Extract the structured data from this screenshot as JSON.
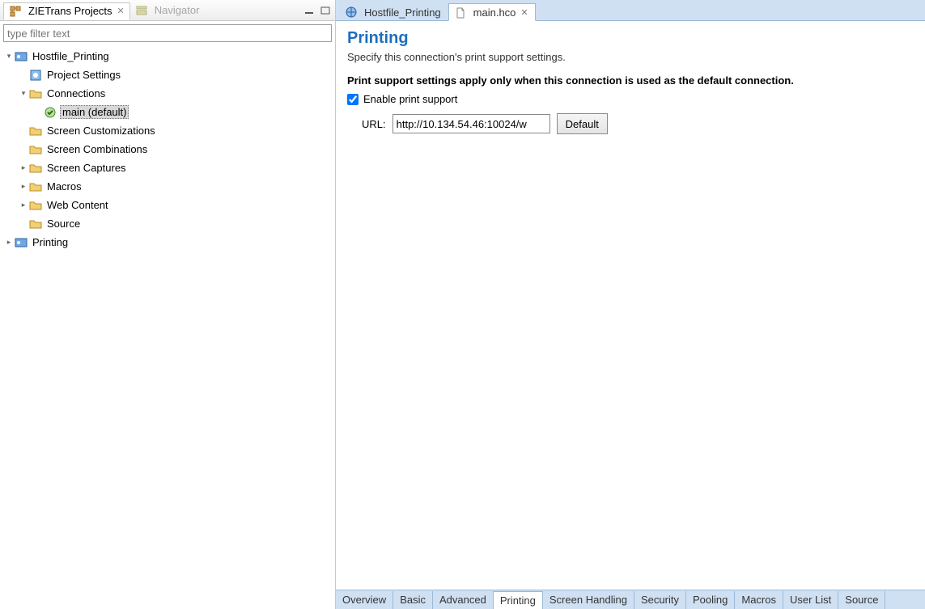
{
  "left": {
    "views": [
      {
        "label": "ZIETrans Projects",
        "active": true
      },
      {
        "label": "Navigator",
        "active": false
      }
    ],
    "filter_placeholder": "type filter text",
    "tree": {
      "root": "Hostfile_Printing",
      "items": {
        "project_settings": "Project Settings",
        "connections": "Connections",
        "main_default": "main (default)",
        "screen_customizations": "Screen Customizations",
        "screen_combinations": "Screen Combinations",
        "screen_captures": "Screen Captures",
        "macros": "Macros",
        "web_content": "Web Content",
        "source": "Source",
        "printing": "Printing"
      }
    }
  },
  "editor": {
    "tabs": [
      {
        "label": "Hostfile_Printing",
        "active": false
      },
      {
        "label": "main.hco",
        "active": true
      }
    ],
    "page_title": "Printing",
    "page_subtitle": "Specify this connection's print support settings.",
    "bold_note": "Print support settings apply only when this connection is used as the default connection.",
    "enable_label": "Enable print support",
    "enable_checked": true,
    "url_label": "URL:",
    "url_value": "http://10.134.54.46:10024/w",
    "default_button": "Default",
    "bottom_tabs": [
      "Overview",
      "Basic",
      "Advanced",
      "Printing",
      "Screen Handling",
      "Security",
      "Pooling",
      "Macros",
      "User List",
      "Source"
    ],
    "bottom_active": "Printing"
  }
}
